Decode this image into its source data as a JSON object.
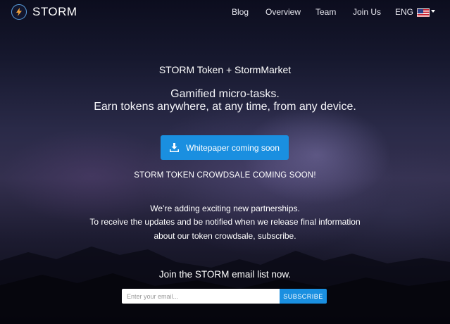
{
  "header": {
    "brand": "STORM",
    "nav": [
      "Blog",
      "Overview",
      "Team",
      "Join Us"
    ],
    "language": "ENG"
  },
  "hero": {
    "title": "STORM Token + StormMarket",
    "tagline_1": "Gamified micro-tasks.",
    "tagline_2": "Earn tokens anywhere, at any time, from any device.",
    "whitepaper_button": "Whitepaper coming soon",
    "crowdsale": "STORM TOKEN CROWDSALE COMING SOON!",
    "info_1": "We’re adding exciting new partnerships.",
    "info_2": "To receive the updates and be notified when we release final information",
    "info_3": "about our token crowdsale, subscribe."
  },
  "signup": {
    "heading": "Join the STORM email list now.",
    "email_placeholder": "Enter your email...",
    "subscribe_button": "SUBSCRIBE"
  },
  "colors": {
    "accent": "#1a8fe0",
    "background": "#0b0c1c"
  },
  "icons": {
    "logo": "lightning-bolt-icon",
    "whitepaper": "download-icon",
    "language": "us-flag-icon"
  }
}
